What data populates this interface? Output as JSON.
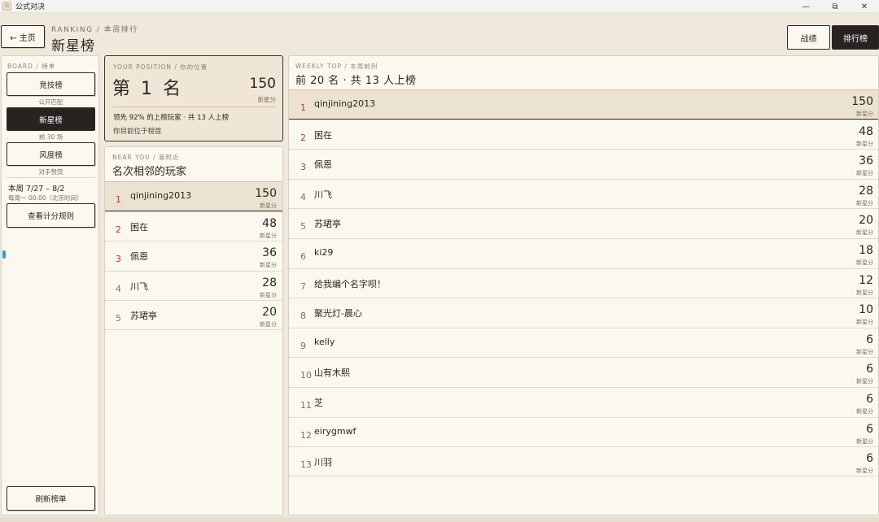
{
  "window": {
    "title": "公式对决",
    "icon": "app-logo-icon",
    "controls": {
      "minimize": "—",
      "restore": "⧉",
      "close": "✕"
    }
  },
  "header": {
    "back_label": "← 主页",
    "eyebrow": "RANKING / 本周排行",
    "title": "新星榜",
    "records_label": "战绩",
    "ranking_label": "排行榜"
  },
  "sidebar": {
    "section_label": "BOARD / 榜单",
    "boards": [
      {
        "label": "竞技榜",
        "caption": "公开匹配",
        "active": false
      },
      {
        "label": "新星榜",
        "caption": "前 30 场",
        "active": true
      },
      {
        "label": "风度榜",
        "caption": "对手赞赏",
        "active": false
      }
    ],
    "week_range": "本周 7/27 – 8/2",
    "week_reset": "每周一 00:00（北京时间）",
    "rules_label": "查看计分规则",
    "refresh_label": "刷新榜单"
  },
  "position": {
    "label": "YOUR POSITION / 你的位置",
    "rank_text": "第 1 名",
    "score": "150",
    "unit": "新星分",
    "lead_text": "领先 92% 的上榜玩家 · 共 13 人上榜",
    "status_text": "你目前位于榜首"
  },
  "near": {
    "label": "NEAR YOU / 我附近",
    "title": "名次相邻的玩家",
    "rows": [
      {
        "rank": "1",
        "name": "qinjining2013",
        "score": "150",
        "unit": "新星分",
        "me": true,
        "top3": true
      },
      {
        "rank": "2",
        "name": "困在",
        "score": "48",
        "unit": "新星分",
        "me": false,
        "top3": true
      },
      {
        "rank": "3",
        "name": "佩恩",
        "score": "36",
        "unit": "新星分",
        "me": false,
        "top3": true
      },
      {
        "rank": "4",
        "name": "川飞",
        "score": "28",
        "unit": "新星分",
        "me": false,
        "top3": false
      },
      {
        "rank": "5",
        "name": "苏珺亭",
        "score": "20",
        "unit": "新星分",
        "me": false,
        "top3": false
      }
    ]
  },
  "weekly": {
    "label": "WEEKLY TOP / 本周前列",
    "title": "前 20 名 · 共 13 人上榜",
    "rows": [
      {
        "rank": "1",
        "name": "qinjining2013",
        "score": "150",
        "unit": "新星分",
        "me": true,
        "top3": true
      },
      {
        "rank": "2",
        "name": "困在",
        "score": "48",
        "unit": "新星分",
        "me": false,
        "top3": true
      },
      {
        "rank": "3",
        "name": "佩恩",
        "score": "36",
        "unit": "新星分",
        "me": false,
        "top3": true
      },
      {
        "rank": "4",
        "name": "川飞",
        "score": "28",
        "unit": "新星分",
        "me": false,
        "top3": false
      },
      {
        "rank": "5",
        "name": "苏珺亭",
        "score": "20",
        "unit": "新星分",
        "me": false,
        "top3": false
      },
      {
        "rank": "6",
        "name": "ki29",
        "score": "18",
        "unit": "新星分",
        "me": false,
        "top3": false
      },
      {
        "rank": "7",
        "name": "给我编个名字呗！",
        "score": "12",
        "unit": "新星分",
        "me": false,
        "top3": false
      },
      {
        "rank": "8",
        "name": "聚光灯-晨心",
        "score": "10",
        "unit": "新星分",
        "me": false,
        "top3": false
      },
      {
        "rank": "9",
        "name": "kelly",
        "score": "6",
        "unit": "新星分",
        "me": false,
        "top3": false
      },
      {
        "rank": "10",
        "name": "山有木熙",
        "score": "6",
        "unit": "新星分",
        "me": false,
        "top3": false
      },
      {
        "rank": "11",
        "name": "芝",
        "score": "6",
        "unit": "新星分",
        "me": false,
        "top3": false
      },
      {
        "rank": "12",
        "name": "eirygmwf",
        "score": "6",
        "unit": "新星分",
        "me": false,
        "top3": false
      },
      {
        "rank": "13",
        "name": "川羽",
        "score": "6",
        "unit": "新星分",
        "me": false,
        "top3": false
      }
    ]
  },
  "colors": {
    "accent_red": "#c0392b",
    "dark": "#262320",
    "panel": "#fbf8f0",
    "background": "#efe8db"
  }
}
